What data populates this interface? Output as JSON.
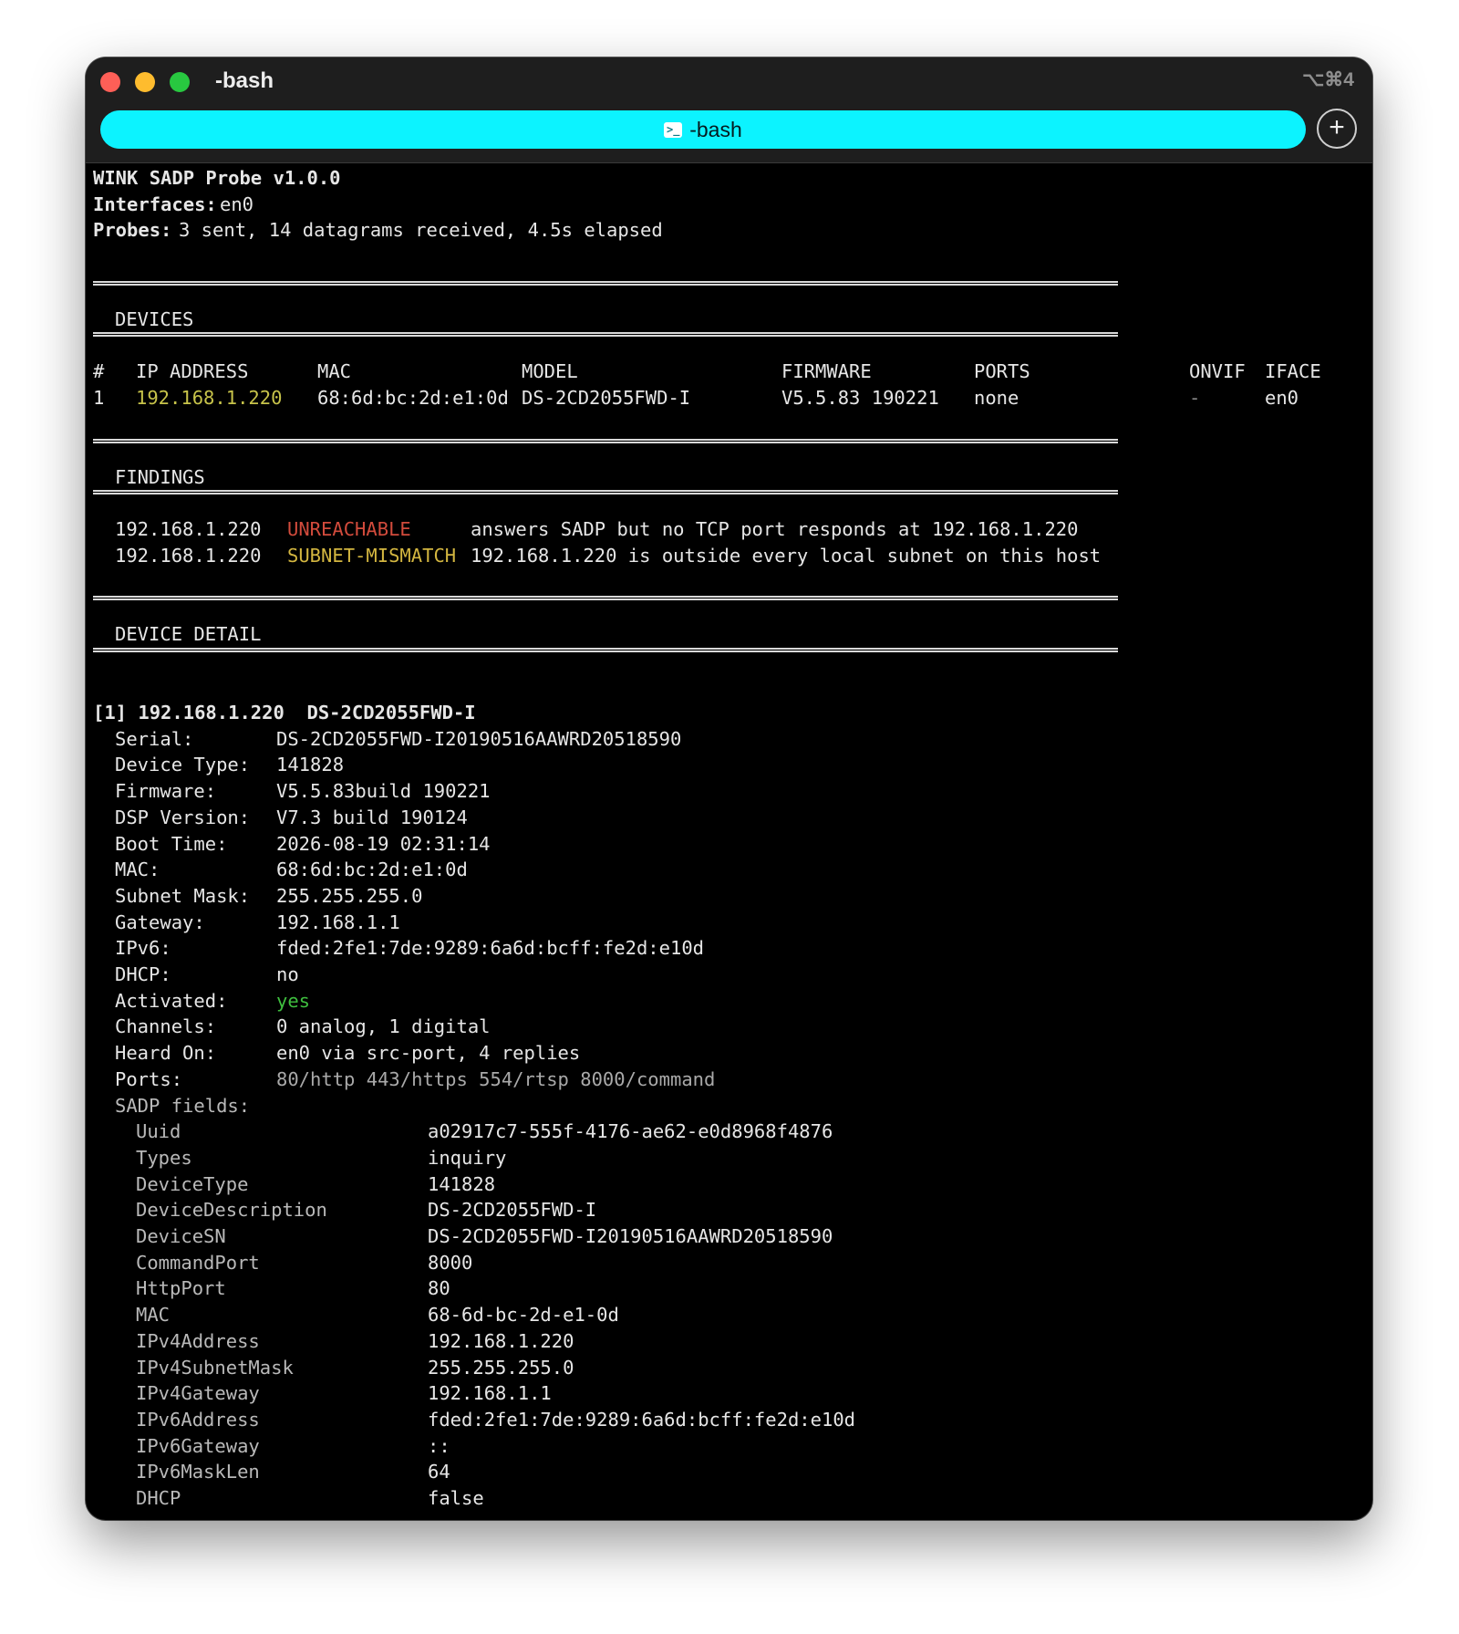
{
  "window": {
    "title": "-bash",
    "shortcut": "⌥⌘4",
    "tab_label": "-bash"
  },
  "header": {
    "app_line": "WINK SADP Probe v1.0.0",
    "interfaces_label": "Interfaces:",
    "interfaces_value": "en0",
    "probes_label": "Probes:",
    "probes_value": "3 sent, 14 datagrams received, 4.5s elapsed"
  },
  "devices": {
    "heading": "DEVICES",
    "columns": [
      "#",
      "IP ADDRESS",
      "MAC",
      "MODEL",
      "FIRMWARE",
      "PORTS",
      "ONVIF",
      "IFACE"
    ],
    "rows": [
      [
        "1",
        "192.168.1.220",
        "68:6d:bc:2d:e1:0d",
        "DS-2CD2055FWD-I",
        "V5.5.83 190221",
        "none",
        "-",
        "en0"
      ]
    ]
  },
  "findings": {
    "heading": "FINDINGS",
    "rows": [
      {
        "ip": "192.168.1.220",
        "code": "UNREACHABLE",
        "text": "answers SADP but no TCP port responds at 192.168.1.220",
        "color": "#d24b3c"
      },
      {
        "ip": "192.168.1.220",
        "code": "SUBNET-MISMATCH",
        "text": "192.168.1.220 is outside every local subnet on this host",
        "color": "#d3b640"
      }
    ]
  },
  "detail": {
    "heading": "DEVICE DETAIL",
    "device_header": "[1] 192.168.1.220  DS-2CD2055FWD-I",
    "fields": [
      {
        "label": "Serial:",
        "value": "DS-2CD2055FWD-I20190516AAWRD20518590"
      },
      {
        "label": "Device Type:",
        "value": "141828"
      },
      {
        "label": "Firmware:",
        "value": "V5.5.83build 190221"
      },
      {
        "label": "DSP Version:",
        "value": "V7.3 build 190124"
      },
      {
        "label": "Boot Time:",
        "value": "2026-08-19 02:31:14"
      },
      {
        "label": "MAC:",
        "value": "68:6d:bc:2d:e1:0d"
      },
      {
        "label": "Subnet Mask:",
        "value": "255.255.255.0"
      },
      {
        "label": "Gateway:",
        "value": "192.168.1.1"
      },
      {
        "label": "IPv6:",
        "value": "fded:2fe1:7de:9289:6a6d:bcff:fe2d:e10d"
      },
      {
        "label": "DHCP:",
        "value": "no"
      },
      {
        "label": "Activated:",
        "value": "yes",
        "color": "#3fbf3f"
      },
      {
        "label": "Channels:",
        "value": "0 analog, 1 digital"
      },
      {
        "label": "Heard On:",
        "value": "en0 via src-port, 4 replies"
      },
      {
        "label": "Ports:",
        "value": "80/http 443/https 554/rtsp 8000/command",
        "dim": true
      }
    ],
    "sadp_label": "SADP fields:",
    "sadp_fields": [
      {
        "key": "Uuid",
        "value": "a02917c7-555f-4176-ae62-e0d8968f4876"
      },
      {
        "key": "Types",
        "value": "inquiry"
      },
      {
        "key": "DeviceType",
        "value": "141828"
      },
      {
        "key": "DeviceDescription",
        "value": "DS-2CD2055FWD-I"
      },
      {
        "key": "DeviceSN",
        "value": "DS-2CD2055FWD-I20190516AAWRD20518590"
      },
      {
        "key": "CommandPort",
        "value": "8000"
      },
      {
        "key": "HttpPort",
        "value": "80"
      },
      {
        "key": "MAC",
        "value": "68-6d-bc-2d-e1-0d"
      },
      {
        "key": "IPv4Address",
        "value": "192.168.1.220"
      },
      {
        "key": "IPv4SubnetMask",
        "value": "255.255.255.0"
      },
      {
        "key": "IPv4Gateway",
        "value": "192.168.1.1"
      },
      {
        "key": "IPv6Address",
        "value": "fded:2fe1:7de:9289:6a6d:bcff:fe2d:e10d"
      },
      {
        "key": "IPv6Gateway",
        "value": "::"
      },
      {
        "key": "IPv6MaskLen",
        "value": "64"
      },
      {
        "key": "DHCP",
        "value": "false"
      }
    ]
  }
}
